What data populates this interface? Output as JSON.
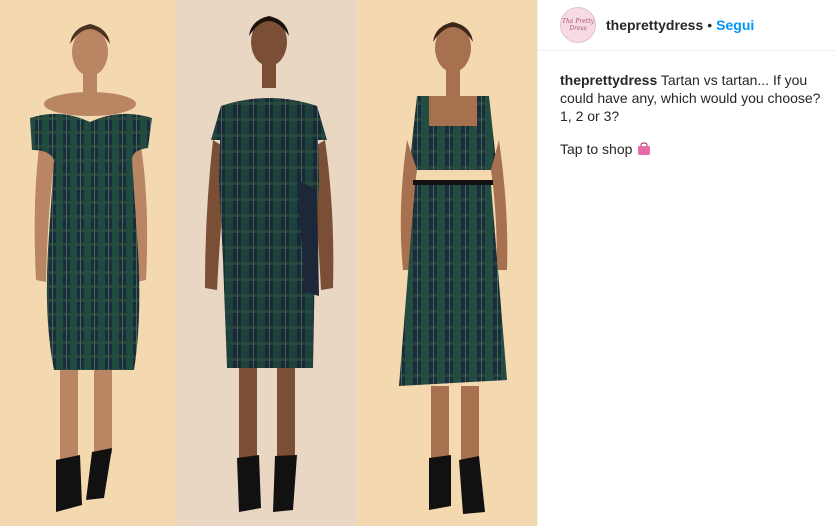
{
  "post": {
    "username": "theprettydress",
    "separator": "•",
    "follow_label": "Segui",
    "avatar_text": "The Pretty Dress",
    "caption_user": "theprettydress",
    "caption_text": " Tartan vs tartan... If you could have any, which would you choose? 1, 2 or 3?",
    "shop_text": "Tap to shop",
    "shop_icon": "shopping-bag-icon"
  },
  "colors": {
    "follow": "#0095f6",
    "tartan_dark": "#1d2c3a",
    "tartan_green": "#1f5a45"
  }
}
